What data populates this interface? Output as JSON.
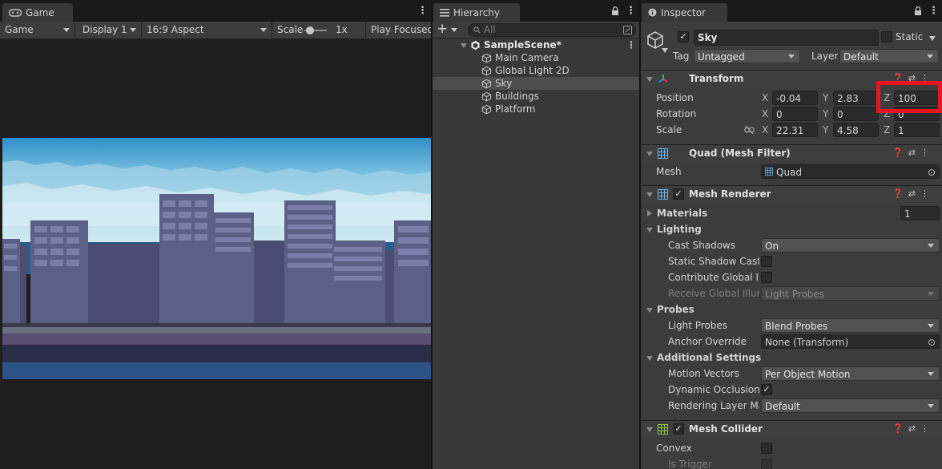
{
  "game": {
    "tab_label": "Game",
    "toolbar": {
      "mode": "Game",
      "display": "Display 1",
      "aspect": "16:9 Aspect",
      "scale_label": "Scale",
      "scale_value": "1x",
      "play_focused": "Play Focused"
    }
  },
  "hierarchy": {
    "tab_label": "Hierarchy",
    "search_placeholder": "All",
    "add_label": "+",
    "scene_name": "SampleScene*",
    "items": [
      {
        "label": "Main Camera",
        "selected": false
      },
      {
        "label": "Global Light 2D",
        "selected": false
      },
      {
        "label": "Sky",
        "selected": true
      },
      {
        "label": "Buildings",
        "selected": false
      },
      {
        "label": "Platform",
        "selected": false
      }
    ]
  },
  "inspector": {
    "tab_label": "Inspector",
    "object_name": "Sky",
    "active": true,
    "static_label": "Static",
    "tag_label": "Tag",
    "tag_value": "Untagged",
    "layer_label": "Layer",
    "layer_value": "Default",
    "transform": {
      "title": "Transform",
      "position_label": "Position",
      "rotation_label": "Rotation",
      "scale_label": "Scale",
      "axis_x": "X",
      "axis_y": "Y",
      "axis_z": "Z",
      "position": {
        "x": "-0.04",
        "y": "2.83",
        "z": "100"
      },
      "rotation": {
        "x": "0",
        "y": "0",
        "z": "0"
      },
      "scale": {
        "x": "22.31",
        "y": "4.58",
        "z": "1"
      }
    },
    "mesh_filter": {
      "title": "Quad (Mesh Filter)",
      "mesh_label": "Mesh",
      "mesh_value": "Quad"
    },
    "mesh_renderer": {
      "title": "Mesh Renderer",
      "enabled": true,
      "materials_label": "Materials",
      "materials_count": "1",
      "lighting_label": "Lighting",
      "cast_shadows_label": "Cast Shadows",
      "cast_shadows_value": "On",
      "static_shadow_label": "Static Shadow Caste",
      "contribute_gi_label": "Contribute Global Illu",
      "receive_gi_label": "Receive Global Illum",
      "receive_gi_value": "Light Probes",
      "probes_label": "Probes",
      "light_probes_label": "Light Probes",
      "light_probes_value": "Blend Probes",
      "anchor_override_label": "Anchor Override",
      "anchor_override_value": "None (Transform)",
      "additional_label": "Additional Settings",
      "motion_vectors_label": "Motion Vectors",
      "motion_vectors_value": "Per Object Motion",
      "dynamic_occlusion_label": "Dynamic Occlusion",
      "dynamic_occlusion": true,
      "rendering_layer_label": "Rendering Layer Ma",
      "rendering_layer_value": "Default"
    },
    "mesh_collider": {
      "title": "Mesh Collider",
      "enabled": true,
      "convex_label": "Convex",
      "is_trigger_label": "Is Trigger"
    }
  },
  "colors": {
    "highlight": "#e8141e",
    "selection": "#4d4d4d",
    "sky_top": "#3a9ad0",
    "sky_bottom": "#bfe0ee",
    "building": "#5c5f86",
    "ground": "#2d5386"
  }
}
